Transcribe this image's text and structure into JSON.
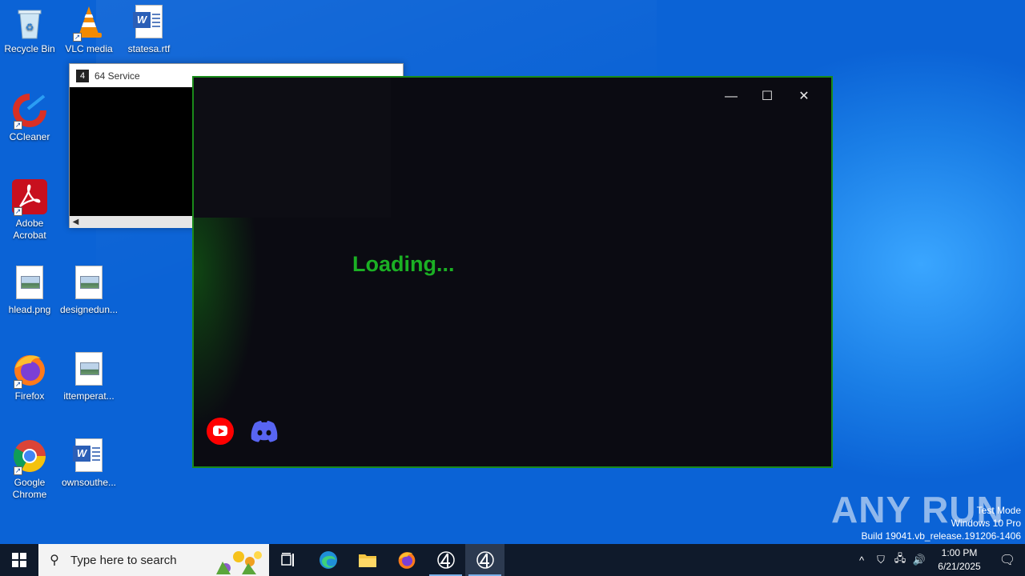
{
  "desktop": {
    "icons": [
      {
        "label": "Recycle Bin",
        "icon": "recycle-bin-icon"
      },
      {
        "label": "VLC media",
        "icon": "vlc-icon"
      },
      {
        "label": "statesa.rtf",
        "icon": "word-doc-icon"
      },
      {
        "label": "CCleaner",
        "icon": "ccleaner-icon"
      },
      {
        "label": "Adobe Acrobat",
        "icon": "acrobat-icon"
      },
      {
        "label": "hlead.png",
        "icon": "image-file-icon"
      },
      {
        "label": "designedun...",
        "icon": "image-file-icon"
      },
      {
        "label": "Firefox",
        "icon": "firefox-icon"
      },
      {
        "label": "ittemperat...",
        "icon": "image-file-icon"
      },
      {
        "label": "Google Chrome",
        "icon": "chrome-icon"
      },
      {
        "label": "ownsouthe...",
        "icon": "word-doc-icon"
      }
    ]
  },
  "service_window": {
    "title": "64 Service",
    "app_glyph": "4"
  },
  "loader_window": {
    "loading_text": "Loading...",
    "border_color": "#1a8a1a",
    "text_color": "#1bb024",
    "controls": {
      "minimize": "—",
      "maximize": "☐",
      "close": "✕"
    },
    "links": [
      {
        "name": "YouTube",
        "icon": "youtube-icon"
      },
      {
        "name": "Discord",
        "icon": "discord-icon"
      }
    ]
  },
  "watermark": {
    "brand": "ANY RUN",
    "line1": "Test Mode",
    "line2": "Windows 10 Pro",
    "line3": "Build 19041.vb_release.191206-1406"
  },
  "taskbar": {
    "search_placeholder": "Type here to search",
    "apps": [
      "task-view-icon",
      "edge-icon",
      "file-explorer-icon",
      "firefox-icon",
      "app-4-icon",
      "app-4-icon"
    ],
    "time": "1:00 PM",
    "date": "6/21/2025"
  }
}
